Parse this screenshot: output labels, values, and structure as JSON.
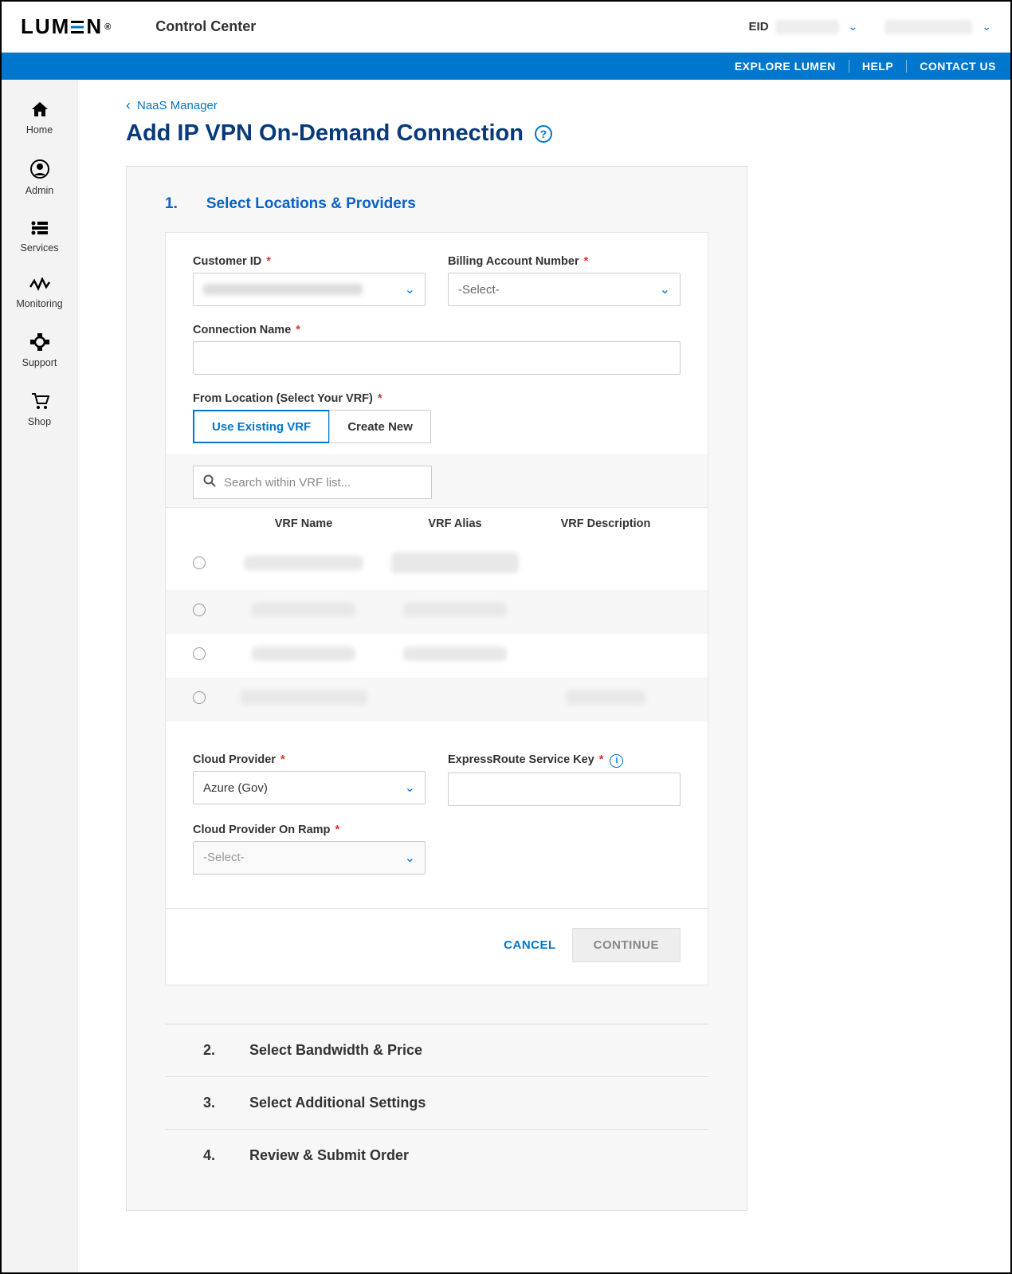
{
  "header": {
    "logo_text": "LUM",
    "logo_text2": "N",
    "control_center": "Control Center",
    "eid_label": "EID"
  },
  "bluebar": {
    "explore": "EXPLORE LUMEN",
    "help": "HELP",
    "contact": "CONTACT US"
  },
  "sidebar": {
    "items": [
      {
        "label": "Home"
      },
      {
        "label": "Admin"
      },
      {
        "label": "Services"
      },
      {
        "label": "Monitoring"
      },
      {
        "label": "Support"
      },
      {
        "label": "Shop"
      }
    ]
  },
  "breadcrumb": {
    "label": "NaaS Manager"
  },
  "page": {
    "title": "Add IP VPN On-Demand Connection"
  },
  "step1": {
    "number": "1.",
    "title": "Select Locations & Providers",
    "customer_id_label": "Customer ID",
    "billing_label": "Billing Account Number",
    "billing_placeholder": "-Select-",
    "connection_name_label": "Connection Name",
    "from_location_label": "From Location (Select Your VRF)",
    "use_existing": "Use Existing VRF",
    "create_new": "Create New",
    "search_placeholder": "Search within VRF list...",
    "vrf_headers": {
      "name": "VRF Name",
      "alias": "VRF Alias",
      "desc": "VRF Description"
    },
    "cloud_provider_label": "Cloud Provider",
    "cloud_provider_value": "Azure (Gov)",
    "express_key_label": "ExpressRoute Service Key",
    "onramp_label": "Cloud Provider On Ramp",
    "onramp_placeholder": "-Select-",
    "cancel": "CANCEL",
    "continue": "CONTINUE"
  },
  "steps_rest": [
    {
      "num": "2.",
      "title": "Select Bandwidth & Price"
    },
    {
      "num": "3.",
      "title": "Select Additional Settings"
    },
    {
      "num": "4.",
      "title": "Review & Submit Order"
    }
  ]
}
